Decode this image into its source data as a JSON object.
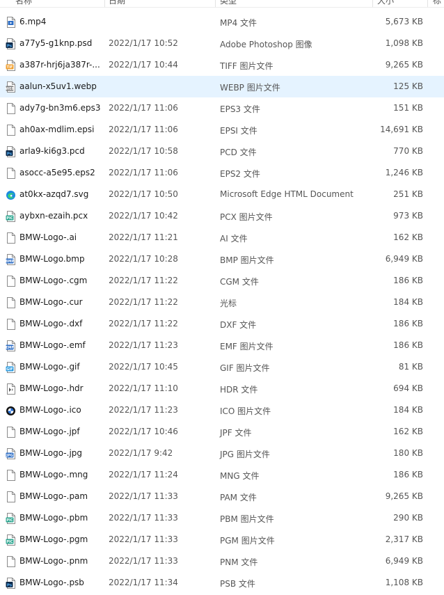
{
  "columns": {
    "name": "名称",
    "date": "日期",
    "type": "类型",
    "size": "大小",
    "tags": "标"
  },
  "files": [
    {
      "name": "6.mp4",
      "date": "",
      "type": "MP4 文件",
      "size": "5,673 KB",
      "icon": "video-file-icon"
    },
    {
      "name": "a77y5-g1knp.psd",
      "date": "2022/1/17 10:52",
      "type": "Adobe Photoshop 图像",
      "size": "1,098 KB",
      "icon": "photoshop-file-icon"
    },
    {
      "name": "a387r-hrj6ja387r-...",
      "date": "2022/1/17 10:44",
      "type": "TIFF 图片文件",
      "size": "9,265 KB",
      "icon": "tiff-file-icon"
    },
    {
      "name": "aalun-x5uv1.webp",
      "date": "",
      "type": "WEBP 图片文件",
      "size": "125 KB",
      "icon": "webp-file-icon",
      "selected": true
    },
    {
      "name": "ady7g-bn3m6.eps3",
      "date": "2022/1/17 11:06",
      "type": "EPS3 文件",
      "size": "151 KB",
      "icon": "blank-file-icon"
    },
    {
      "name": "ah0ax-mdlim.epsi",
      "date": "2022/1/17 11:06",
      "type": "EPSI 文件",
      "size": "14,691 KB",
      "icon": "blank-file-icon"
    },
    {
      "name": "arla9-ki6g3.pcd",
      "date": "2022/1/17 10:58",
      "type": "PCD 文件",
      "size": "770 KB",
      "icon": "photoshop-file-icon"
    },
    {
      "name": "asocc-a5e95.eps2",
      "date": "2022/1/17 11:06",
      "type": "EPS2 文件",
      "size": "1,246 KB",
      "icon": "blank-file-icon"
    },
    {
      "name": "at0kx-azqd7.svg",
      "date": "2022/1/17 10:50",
      "type": "Microsoft Edge HTML Document",
      "size": "251 KB",
      "icon": "edge-icon"
    },
    {
      "name": "aybxn-ezaih.pcx",
      "date": "2022/1/17 10:42",
      "type": "PCX 图片文件",
      "size": "973 KB",
      "icon": "pic-file-icon"
    },
    {
      "name": "BMW-Logo-.ai",
      "date": "2022/1/17 11:21",
      "type": "AI 文件",
      "size": "162 KB",
      "icon": "blank-file-icon"
    },
    {
      "name": "BMW-Logo.bmp",
      "date": "2022/1/17 10:28",
      "type": "BMP 图片文件",
      "size": "6,949 KB",
      "icon": "bmp-file-icon"
    },
    {
      "name": "BMW-Logo-.cgm",
      "date": "2022/1/17 11:22",
      "type": "CGM 文件",
      "size": "186 KB",
      "icon": "blank-file-icon"
    },
    {
      "name": "BMW-Logo-.cur",
      "date": "2022/1/17 11:22",
      "type": "光标",
      "size": "184 KB",
      "icon": "blank-file-icon"
    },
    {
      "name": "BMW-Logo-.dxf",
      "date": "2022/1/17 11:22",
      "type": "DXF 文件",
      "size": "186 KB",
      "icon": "blank-file-icon"
    },
    {
      "name": "BMW-Logo-.emf",
      "date": "2022/1/17 11:23",
      "type": "EMF 图片文件",
      "size": "186 KB",
      "icon": "emf-file-icon"
    },
    {
      "name": "BMW-Logo-.gif",
      "date": "2022/1/17 10:45",
      "type": "GIF 图片文件",
      "size": "81 KB",
      "icon": "gif-file-icon"
    },
    {
      "name": "BMW-Logo-.hdr",
      "date": "2022/1/17 11:10",
      "type": "HDR 文件",
      "size": "694 KB",
      "icon": "hdr-file-icon"
    },
    {
      "name": "BMW-Logo-.ico",
      "date": "2022/1/17 11:23",
      "type": "ICO 图片文件",
      "size": "184 KB",
      "icon": "bmw-logo-icon"
    },
    {
      "name": "BMW-Logo-.jpf",
      "date": "2022/1/17 10:46",
      "type": "JPF 文件",
      "size": "162 KB",
      "icon": "blank-file-icon"
    },
    {
      "name": "BMW-Logo-.jpg",
      "date": "2022/1/17 9:42",
      "type": "JPG 图片文件",
      "size": "180 KB",
      "icon": "jpg-file-icon"
    },
    {
      "name": "BMW-Logo-.mng",
      "date": "2022/1/17 11:24",
      "type": "MNG 文件",
      "size": "186 KB",
      "icon": "blank-file-icon"
    },
    {
      "name": "BMW-Logo-.pam",
      "date": "2022/1/17 11:33",
      "type": "PAM 文件",
      "size": "9,265 KB",
      "icon": "blank-file-icon"
    },
    {
      "name": "BMW-Logo-.pbm",
      "date": "2022/1/17 11:33",
      "type": "PBM 图片文件",
      "size": "290 KB",
      "icon": "pic-file-icon"
    },
    {
      "name": "BMW-Logo-.pgm",
      "date": "2022/1/17 11:33",
      "type": "PGM 图片文件",
      "size": "2,317 KB",
      "icon": "pic-file-icon"
    },
    {
      "name": "BMW-Logo-.pnm",
      "date": "2022/1/17 11:33",
      "type": "PNM 文件",
      "size": "6,949 KB",
      "icon": "blank-file-icon"
    },
    {
      "name": "BMW-Logo-.psb",
      "date": "2022/1/17 11:34",
      "type": "PSB 文件",
      "size": "1,108 KB",
      "icon": "photoshop-file-icon"
    }
  ],
  "colors": {
    "selected_row": "#e5f3ff",
    "pic_badge": "#2aa58f",
    "blue_badge": "#2b6cc4",
    "orange_badge": "#f0a030",
    "photoshop": "#0d2a4a"
  }
}
